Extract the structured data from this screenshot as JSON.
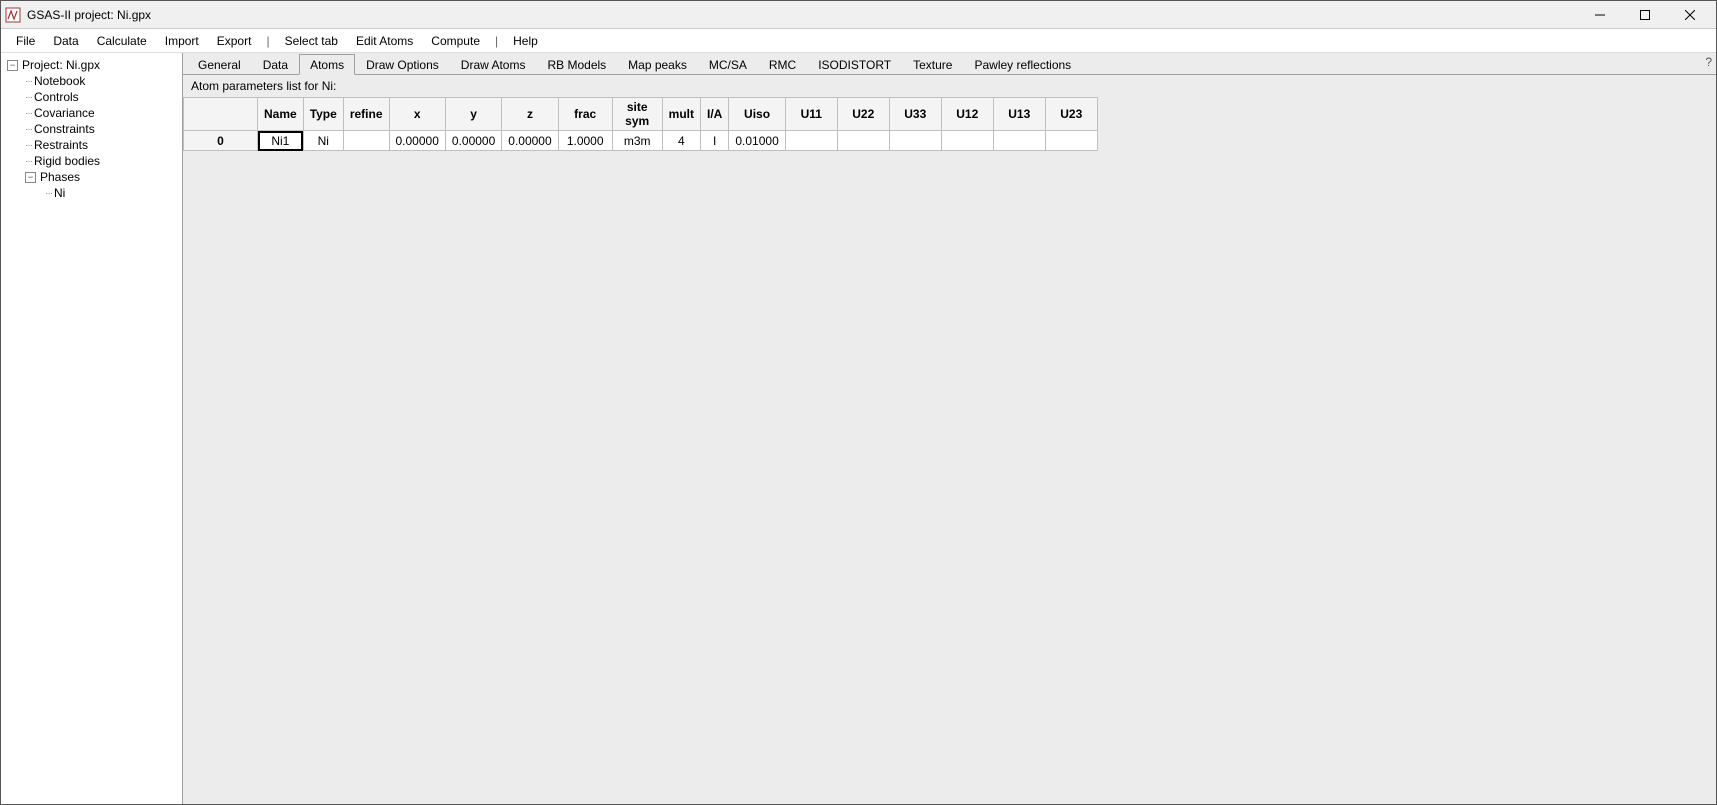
{
  "window": {
    "title": "GSAS-II project: Ni.gpx"
  },
  "menubar": {
    "items": [
      "File",
      "Data",
      "Calculate",
      "Import",
      "Export"
    ],
    "sep": "|",
    "items2": [
      "Select tab",
      "Edit Atoms",
      "Compute"
    ],
    "items3": [
      "Help"
    ]
  },
  "tree": {
    "root": "Project: Ni.gpx",
    "children": [
      "Notebook",
      "Controls",
      "Covariance",
      "Constraints",
      "Restraints",
      "Rigid bodies"
    ],
    "phases_label": "Phases",
    "phase_children": [
      "Ni"
    ]
  },
  "tabs": {
    "items": [
      "General",
      "Data",
      "Atoms",
      "Draw Options",
      "Draw Atoms",
      "RB Models",
      "Map peaks",
      "MC/SA",
      "RMC",
      "ISODISTORT",
      "Texture",
      "Pawley reflections"
    ],
    "active_index": 2
  },
  "subheader": "Atom parameters list for Ni:",
  "help_corner": "?",
  "table": {
    "columns": [
      "Name",
      "Type",
      "refine",
      "x",
      "y",
      "z",
      "frac",
      "site sym",
      "mult",
      "I/A",
      "Uiso",
      "U11",
      "U22",
      "U33",
      "U12",
      "U13",
      "U23"
    ],
    "rows": [
      {
        "idx": "0",
        "Name": "Ni1",
        "Type": "Ni",
        "refine": "",
        "x": "0.00000",
        "y": "0.00000",
        "z": "0.00000",
        "frac": "1.0000",
        "site_sym": "m3m",
        "mult": "4",
        "IA": "I",
        "Uiso": "0.01000",
        "U11": "",
        "U22": "",
        "U33": "",
        "U12": "",
        "U13": "",
        "U23": ""
      }
    ]
  }
}
